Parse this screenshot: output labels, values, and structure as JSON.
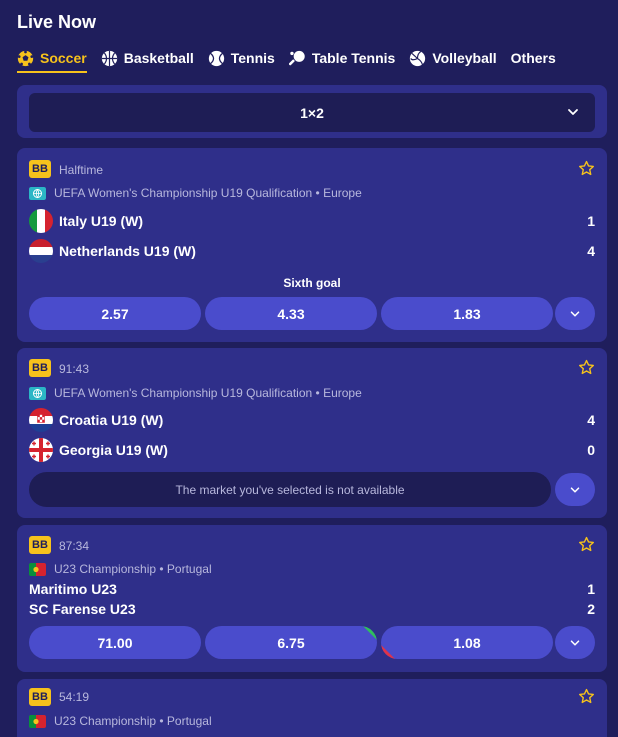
{
  "page": {
    "title": "Live Now"
  },
  "tabs": [
    {
      "label": "Soccer",
      "icon": "soccer-ball-icon",
      "active": true
    },
    {
      "label": "Basketball",
      "icon": "basketball-icon"
    },
    {
      "label": "Tennis",
      "icon": "tennis-ball-icon"
    },
    {
      "label": "Table Tennis",
      "icon": "table-tennis-icon"
    },
    {
      "label": "Volleyball",
      "icon": "volleyball-icon"
    },
    {
      "label": "Others"
    }
  ],
  "market_selector": {
    "value": "1×2"
  },
  "colors": {
    "accent": "#f6c21c",
    "card": "#2f2f8a",
    "odds": "#4a4ccc",
    "up": "#2fbf5a",
    "down": "#e0334a"
  },
  "matches": [
    {
      "badge": "BB",
      "status": "Halftime",
      "league": "UEFA Women's Championship U19 Qualification • Europe",
      "league_icon": "globe-icon",
      "home": {
        "name": "Italy U19 (W)",
        "score": "1",
        "flag": "italy-flag"
      },
      "away": {
        "name": "Netherlands U19 (W)",
        "score": "4",
        "flag": "netherlands-flag"
      },
      "market_label": "Sixth goal",
      "odds": [
        "2.57",
        "4.33",
        "1.83"
      ]
    },
    {
      "badge": "BB",
      "status": "91:43",
      "league": "UEFA Women's Championship U19 Qualification • Europe",
      "league_icon": "globe-icon",
      "home": {
        "name": "Croatia U19 (W)",
        "score": "4",
        "flag": "croatia-flag"
      },
      "away": {
        "name": "Georgia U19 (W)",
        "score": "0",
        "flag": "georgia-flag"
      },
      "unavailable_text": "The market you've selected is not available"
    },
    {
      "badge": "BB",
      "status": "87:34",
      "league": "U23 Championship • Portugal",
      "league_icon": "portugal-flag",
      "home": {
        "name": "Maritimo U23",
        "score": "1"
      },
      "away": {
        "name": "SC Farense U23",
        "score": "2"
      },
      "odds": [
        "71.00",
        "6.75",
        "1.08"
      ],
      "odds_trend": [
        "none",
        "up",
        "down"
      ]
    },
    {
      "badge": "BB",
      "status": "54:19",
      "league": "U23 Championship • Portugal",
      "league_icon": "portugal-flag"
    }
  ]
}
